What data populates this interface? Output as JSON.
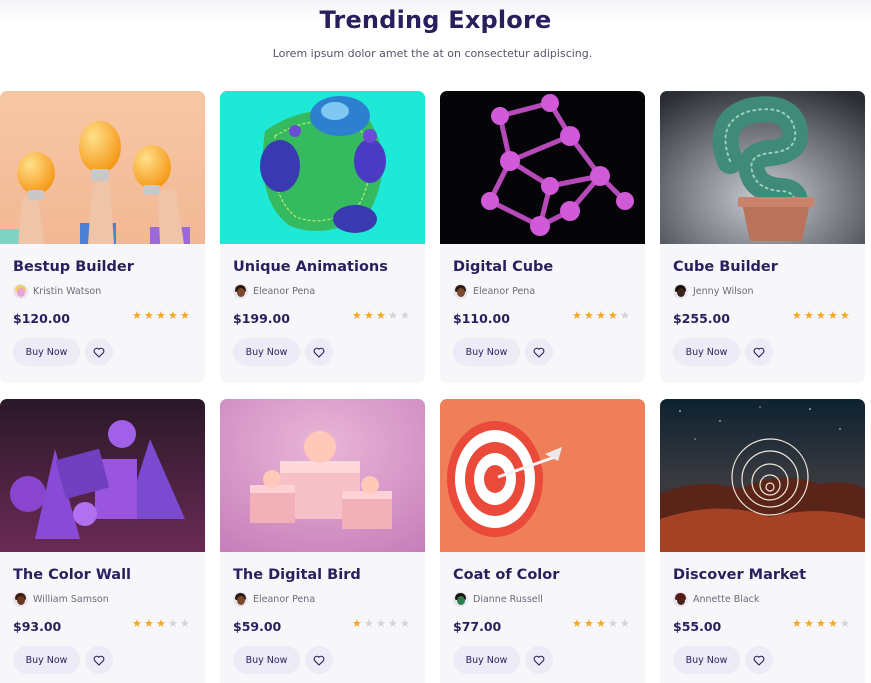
{
  "header": {
    "title": "Trending Explore",
    "subtitle": "Lorem ipsum dolor amet the at on consectetur adipiscing."
  },
  "colors": {
    "title": "#2a1f5c",
    "star_on": "#f5a623",
    "star_off": "#d3d3d8",
    "button_bg": "#ecebf6",
    "card_bg": "#f7f7f9"
  },
  "cards": [
    {
      "title": "Bestup Builder",
      "author": "Kristin Watson",
      "price": "$120.00",
      "rating": 5,
      "buy_label": "Buy Now",
      "image": "lightbulbs-hands",
      "avatar_color": "#e9a3d6"
    },
    {
      "title": "Unique Animations",
      "author": "Eleanor Pena",
      "price": "$199.00",
      "rating": 3,
      "buy_label": "Buy Now",
      "image": "mesh-sculpture",
      "avatar_color": "#7a4a2a"
    },
    {
      "title": "Digital Cube",
      "author": "Eleanor Pena",
      "price": "$110.00",
      "rating": 4,
      "buy_label": "Buy Now",
      "image": "molecule",
      "avatar_color": "#7a4a2a"
    },
    {
      "title": "Cube Builder",
      "author": "Jenny Wilson",
      "price": "$255.00",
      "rating": 5,
      "buy_label": "Buy Now",
      "image": "cactus-pot",
      "avatar_color": "#3a2418"
    },
    {
      "title": "The Color Wall",
      "author": "William Samson",
      "price": "$93.00",
      "rating": 3,
      "buy_label": "Buy Now",
      "image": "purple-shapes",
      "avatar_color": "#6b3a22"
    },
    {
      "title": "The Digital Bird",
      "author": "Eleanor Pena",
      "price": "$59.00",
      "rating": 1,
      "buy_label": "Buy Now",
      "image": "pink-podium",
      "avatar_color": "#7a4a2a"
    },
    {
      "title": "Coat of Color",
      "author": "Dianne Russell",
      "price": "$77.00",
      "rating": 3,
      "buy_label": "Buy Now",
      "image": "target-arrow",
      "avatar_color": "#2e7d4a"
    },
    {
      "title": "Discover Market",
      "author": "Annette Black",
      "price": "$55.00",
      "rating": 4,
      "buy_label": "Buy Now",
      "image": "night-spiral",
      "avatar_color": "#4a2418"
    }
  ]
}
